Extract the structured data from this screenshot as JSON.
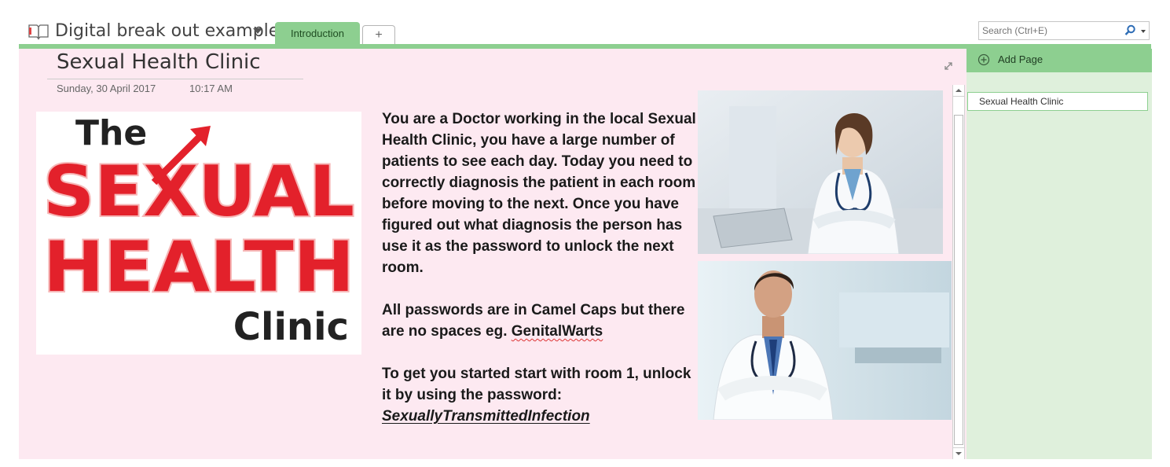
{
  "notebook": {
    "title": "Digital break out example"
  },
  "tabs": [
    {
      "label": "Introduction"
    },
    {
      "label": "+"
    }
  ],
  "search": {
    "placeholder": "Search (Ctrl+E)"
  },
  "page": {
    "title": "Sexual Health Clinic",
    "date": "Sunday, 30 April 2017",
    "time": "10:17 AM",
    "logo": {
      "line1": "The",
      "line2": "SEXUAL",
      "line3": "HEALTH",
      "line4": "Clinic"
    },
    "paragraph1": "You are a Doctor working in the local Sexual Health Clinic, you have a large number of patients to see each day. Today you need to correctly diagnosis the patient in each room before moving to the next. Once you have figured out what diagnosis the person has use it as the password to unlock the next room.",
    "paragraph2_prefix": "All passwords are in Camel Caps but there are no spaces eg. ",
    "paragraph2_example": "GenitalWarts",
    "paragraph3": "To get you started start with room 1, unlock it by using the password:",
    "password": "SexuallyTransmittedInfection"
  },
  "sidebar": {
    "add_page_label": "Add Page",
    "pages": [
      {
        "label": "Sexual Health Clinic"
      }
    ]
  },
  "colors": {
    "accent_green": "#8dcf90",
    "page_background": "#fde9f1",
    "panel_background": "#dff0dc",
    "logo_red": "#e3212b"
  }
}
